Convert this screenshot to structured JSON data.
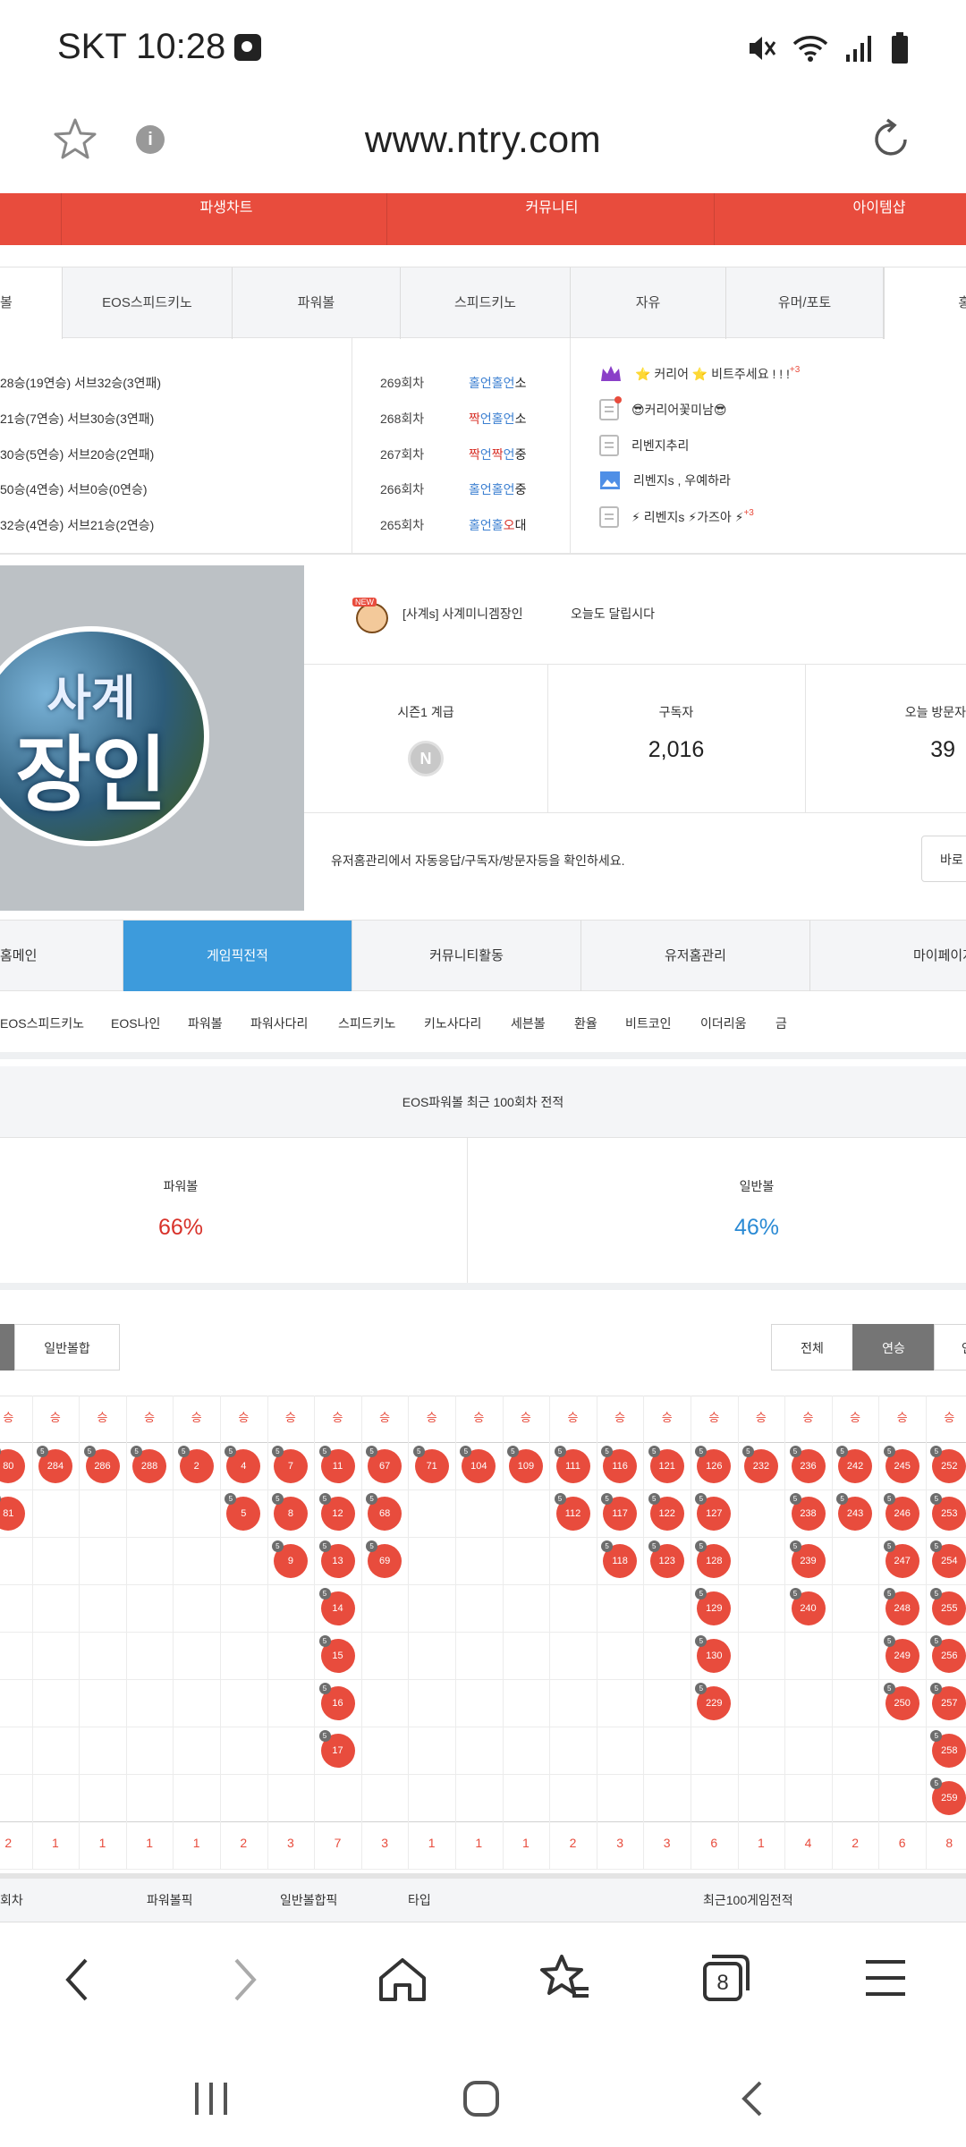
{
  "status": {
    "carrier_time": "SKT 10:28"
  },
  "browser": {
    "url": "www.ntry.com"
  },
  "top_menu": [
    "파생차트",
    "커뮤니티",
    "아이템샵"
  ],
  "board_tabs": [
    "볼",
    "EOS스피드키노",
    "파워볼",
    "스피드키노",
    "자유",
    "유머/포토",
    "홍"
  ],
  "rank_stats": [
    "28승(19연승) 서브32승(3연패)",
    "21승(7연승) 서브30승(3연패)",
    "30승(5연승) 서브20승(2연패)",
    "50승(4연승) 서브0승(0연승)",
    "32승(4연승) 서브21승(2연승)"
  ],
  "rounds": [
    {
      "round": "269회차",
      "parts": [
        {
          "t": "홀",
          "c": "b"
        },
        {
          "t": "언",
          "c": "b"
        },
        {
          "t": "홀",
          "c": "b"
        },
        {
          "t": "언",
          "c": "b"
        },
        {
          "t": "소",
          "c": "k"
        }
      ]
    },
    {
      "round": "268회차",
      "parts": [
        {
          "t": "짝",
          "c": "r"
        },
        {
          "t": "언",
          "c": "b"
        },
        {
          "t": "홀",
          "c": "b"
        },
        {
          "t": "언",
          "c": "b"
        },
        {
          "t": "소",
          "c": "k"
        }
      ]
    },
    {
      "round": "267회차",
      "parts": [
        {
          "t": "짝",
          "c": "r"
        },
        {
          "t": "언",
          "c": "b"
        },
        {
          "t": "짝",
          "c": "r"
        },
        {
          "t": "언",
          "c": "b"
        },
        {
          "t": "중",
          "c": "k"
        }
      ]
    },
    {
      "round": "266회차",
      "parts": [
        {
          "t": "홀",
          "c": "b"
        },
        {
          "t": "언",
          "c": "b"
        },
        {
          "t": "홀",
          "c": "b"
        },
        {
          "t": "언",
          "c": "b"
        },
        {
          "t": "중",
          "c": "k"
        }
      ]
    },
    {
      "round": "265회차",
      "parts": [
        {
          "t": "홀",
          "c": "b"
        },
        {
          "t": "언",
          "c": "b"
        },
        {
          "t": "홀",
          "c": "b"
        },
        {
          "t": "오",
          "c": "r"
        },
        {
          "t": "대",
          "c": "k"
        }
      ]
    }
  ],
  "posts": [
    {
      "text": "⭐ 커리어 ⭐ 비트주세요 ! ! !",
      "badge": "+3",
      "icon": "crown-icon"
    },
    {
      "text": "😎커리어꽃미남😎",
      "badge": "",
      "icon": "document-new-icon"
    },
    {
      "text": "리벤지추리",
      "badge": "",
      "icon": "document-icon"
    },
    {
      "text": "리벤지s , 우예하라",
      "badge": "",
      "icon": "image-icon"
    },
    {
      "text": "⚡ 리벤지s ⚡가즈아 ⚡",
      "badge": "+3",
      "icon": "document-icon"
    }
  ],
  "profile": {
    "logo_top": "사계",
    "logo_bottom": "장인",
    "new_badge": "NEW",
    "name": "[사계s]  사계미니겜장인",
    "motto": "오늘도 달립시다",
    "season_label": "시즌1 계급",
    "rank_badge": "N",
    "subscribers_label": "구독자",
    "subscribers": "2,016",
    "visitors_label": "오늘 방문자",
    "visitors": "39",
    "notice": "유저홈관리에서 자동응답/구독자/방문자등을 확인하세요.",
    "go_button": "바로"
  },
  "user_tabs": [
    "홈메인",
    "게임픽전적",
    "커뮤니티활동",
    "유저홈관리",
    "마이페이지"
  ],
  "games": [
    "EOS스피드키노",
    "EOS나인",
    "파워볼",
    "파워사다리",
    "스피드키노",
    "키노사다리",
    "세븐볼",
    "환율",
    "비트코인",
    "이더리움",
    "금"
  ],
  "summary": {
    "title": "EOS파워볼 최근 100회차 전적",
    "left_label": "파워볼",
    "left_value": "66%",
    "right_label": "일반볼",
    "right_value": "46%"
  },
  "filters": {
    "combo": "일반볼합",
    "all": "전체",
    "streak": "연승",
    "cut": "연"
  },
  "grid": {
    "header": "승",
    "colors": {
      "win": "#e84c3d"
    },
    "columns": [
      {
        "balls": [
          "80",
          "81"
        ],
        "count": "2"
      },
      {
        "balls": [
          "284"
        ],
        "count": "1"
      },
      {
        "balls": [
          "286"
        ],
        "count": "1"
      },
      {
        "balls": [
          "288"
        ],
        "count": "1"
      },
      {
        "balls": [
          "2"
        ],
        "count": "1"
      },
      {
        "balls": [
          "4",
          "5"
        ],
        "count": "2"
      },
      {
        "balls": [
          "7",
          "8",
          "9"
        ],
        "count": "3"
      },
      {
        "balls": [
          "11",
          "12",
          "13",
          "14",
          "15",
          "16",
          "17"
        ],
        "count": "7"
      },
      {
        "balls": [
          "67",
          "68",
          "69"
        ],
        "count": "3"
      },
      {
        "balls": [
          "71"
        ],
        "count": "1"
      },
      {
        "balls": [
          "104"
        ],
        "count": "1"
      },
      {
        "balls": [
          "109"
        ],
        "count": "1"
      },
      {
        "balls": [
          "111",
          "112"
        ],
        "count": "2"
      },
      {
        "balls": [
          "116",
          "117",
          "118"
        ],
        "count": "3"
      },
      {
        "balls": [
          "121",
          "122",
          "123"
        ],
        "count": "3"
      },
      {
        "balls": [
          "126",
          "127",
          "128",
          "129",
          "130",
          "229"
        ],
        "count": "6"
      },
      {
        "balls": [
          "232"
        ],
        "count": "1"
      },
      {
        "balls": [
          "236",
          "238",
          "239",
          "240"
        ],
        "count": "4"
      },
      {
        "balls": [
          "242",
          "243"
        ],
        "count": "2"
      },
      {
        "balls": [
          "245",
          "246",
          "247",
          "248",
          "249",
          "250"
        ],
        "count": "6"
      },
      {
        "balls": [
          "252",
          "253",
          "254",
          "255",
          "256",
          "257",
          "258",
          "259"
        ],
        "count": "8"
      }
    ]
  },
  "footer_labels": [
    "회차",
    "파워볼픽",
    "일반볼합픽",
    "타입",
    "최근100게임전적"
  ]
}
